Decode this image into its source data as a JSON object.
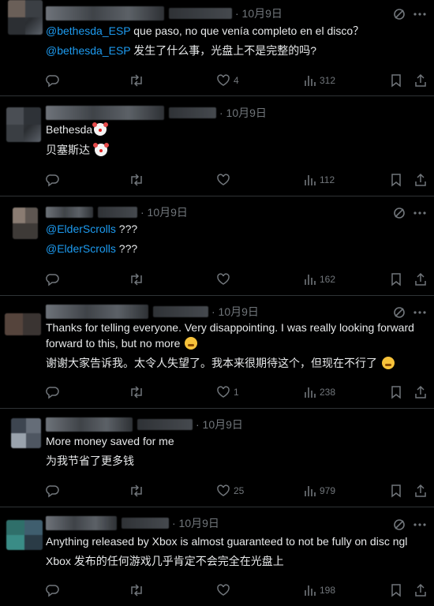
{
  "tweets": [
    {
      "time": "· 10月9日",
      "lines": [
        {
          "mention": "@bethesda_ESP",
          "text": " que paso, no que venía completo en el disco？"
        },
        {
          "mention": "@bethesda_ESP",
          "text": " 发生了什么事，光盘上不是完整的吗?"
        }
      ],
      "stats": {
        "replies": "",
        "reposts": "",
        "likes": "4",
        "views": "312"
      }
    },
    {
      "time": "· 10月9日",
      "lines": [
        {
          "mention": "",
          "text": "Bethesda",
          "emoji": "clown-emoji"
        },
        {
          "mention": "",
          "text": "贝塞斯达 ",
          "emoji": "clown-emoji"
        }
      ],
      "stats": {
        "replies": "",
        "reposts": "",
        "likes": "",
        "views": "112"
      }
    },
    {
      "time": "· 10月9日",
      "lines": [
        {
          "mention": "@ElderScrolls",
          "text": " ???"
        },
        {
          "mention": "@ElderScrolls",
          "text": " ???"
        }
      ],
      "stats": {
        "replies": "",
        "reposts": "",
        "likes": "",
        "views": "162"
      }
    },
    {
      "time": "· 10月9日",
      "lines": [
        {
          "mention": "",
          "text": "Thanks for telling everyone. Very disappointing. I was really looking forward forward to this, but no more ",
          "emoji": "tired-face-emoji"
        },
        {
          "mention": "",
          "text": "谢谢大家告诉我。太令人失望了。我本来很期待这个，但现在不行了 ",
          "emoji": "tired-face-emoji"
        }
      ],
      "stats": {
        "replies": "",
        "reposts": "",
        "likes": "1",
        "views": "238"
      }
    },
    {
      "time": "· 10月9日",
      "lines": [
        {
          "mention": "",
          "text": "More money saved for me"
        },
        {
          "mention": "",
          "text": "为我节省了更多钱"
        }
      ],
      "stats": {
        "replies": "",
        "reposts": "",
        "likes": "25",
        "views": "979"
      }
    },
    {
      "time": "· 10月9日",
      "lines": [
        {
          "mention": "",
          "text": "Anything released by Xbox is almost guaranteed to not be fully on disc ngl"
        },
        {
          "mention": "",
          "text": "Xbox 发布的任何游戏几乎肯定不会完全在光盘上"
        }
      ],
      "stats": {
        "replies": "",
        "reposts": "",
        "likes": "",
        "views": "198"
      }
    }
  ],
  "icons": {
    "reply": "reply-icon",
    "repost": "repost-icon",
    "like": "like-icon",
    "views": "views-icon",
    "bookmark": "bookmark-icon",
    "share": "share-icon",
    "grok": "grok-icon",
    "more": "more-icon"
  },
  "colors": {
    "background": "#000000",
    "text": "#e7e9ea",
    "muted": "#71767b",
    "link": "#1d9bf0",
    "divider": "#2f3336"
  }
}
